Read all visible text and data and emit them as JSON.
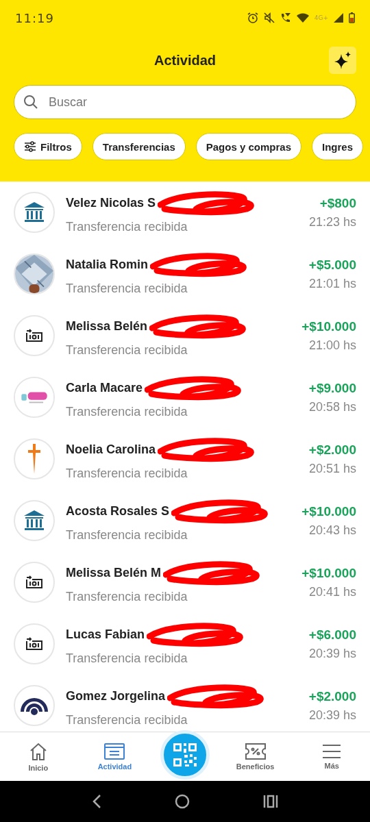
{
  "status_bar": {
    "time": "11:19",
    "network": "4G+"
  },
  "header": {
    "title": "Actividad"
  },
  "search": {
    "placeholder": "Buscar"
  },
  "filters": [
    {
      "label": "Filtros",
      "kind": "filter",
      "selected": false
    },
    {
      "label": "Transferencias",
      "kind": "chip",
      "selected": false
    },
    {
      "label": "Pagos y compras",
      "kind": "chip",
      "selected": false
    },
    {
      "label": "Ingres",
      "kind": "chip",
      "selected": false
    }
  ],
  "transactions": [
    {
      "name": "Velez Nicolas S",
      "kind": "bank",
      "description": "Transferencia recibida",
      "amount": "+$800",
      "time": "21:23 hs"
    },
    {
      "name": "Natalia Romin",
      "kind": "picture",
      "description": "Transferencia recibida",
      "amount": "+$5.000",
      "time": "21:01 hs"
    },
    {
      "name": "Melissa Belén",
      "kind": "transfer",
      "description": "Transferencia recibida",
      "amount": "+$10.000",
      "time": "21:00 hs"
    },
    {
      "name": "Carla Macare",
      "kind": "logo",
      "description": "Transferencia recibida",
      "amount": "+$9.000",
      "time": "20:58 hs"
    },
    {
      "name": "Noelia Carolina",
      "kind": "sword",
      "description": "Transferencia recibida",
      "amount": "+$2.000",
      "time": "20:51 hs"
    },
    {
      "name": "Acosta Rosales S",
      "kind": "bank",
      "description": "Transferencia recibida",
      "amount": "+$10.000",
      "time": "20:43 hs"
    },
    {
      "name": "Melissa Belén M",
      "kind": "transfer",
      "description": "Transferencia recibida",
      "amount": "+$10.000",
      "time": "20:41 hs"
    },
    {
      "name": "Lucas Fabian",
      "kind": "transfer",
      "description": "Transferencia recibida",
      "amount": "+$6.000",
      "time": "20:39 hs"
    },
    {
      "name": "Gomez Jorgelina",
      "kind": "arc",
      "description": "Transferencia recibida",
      "amount": "+$2.000",
      "time": "20:39 hs"
    }
  ],
  "bottom_nav": [
    {
      "label": "Inicio",
      "kind": "home",
      "selected": false
    },
    {
      "label": "Actividad",
      "kind": "activity",
      "selected": true
    },
    {
      "kind": "qr",
      "selected": false
    },
    {
      "label": "Beneficios",
      "kind": "benefits",
      "selected": false
    },
    {
      "label": "Más",
      "kind": "menu",
      "selected": false
    }
  ]
}
